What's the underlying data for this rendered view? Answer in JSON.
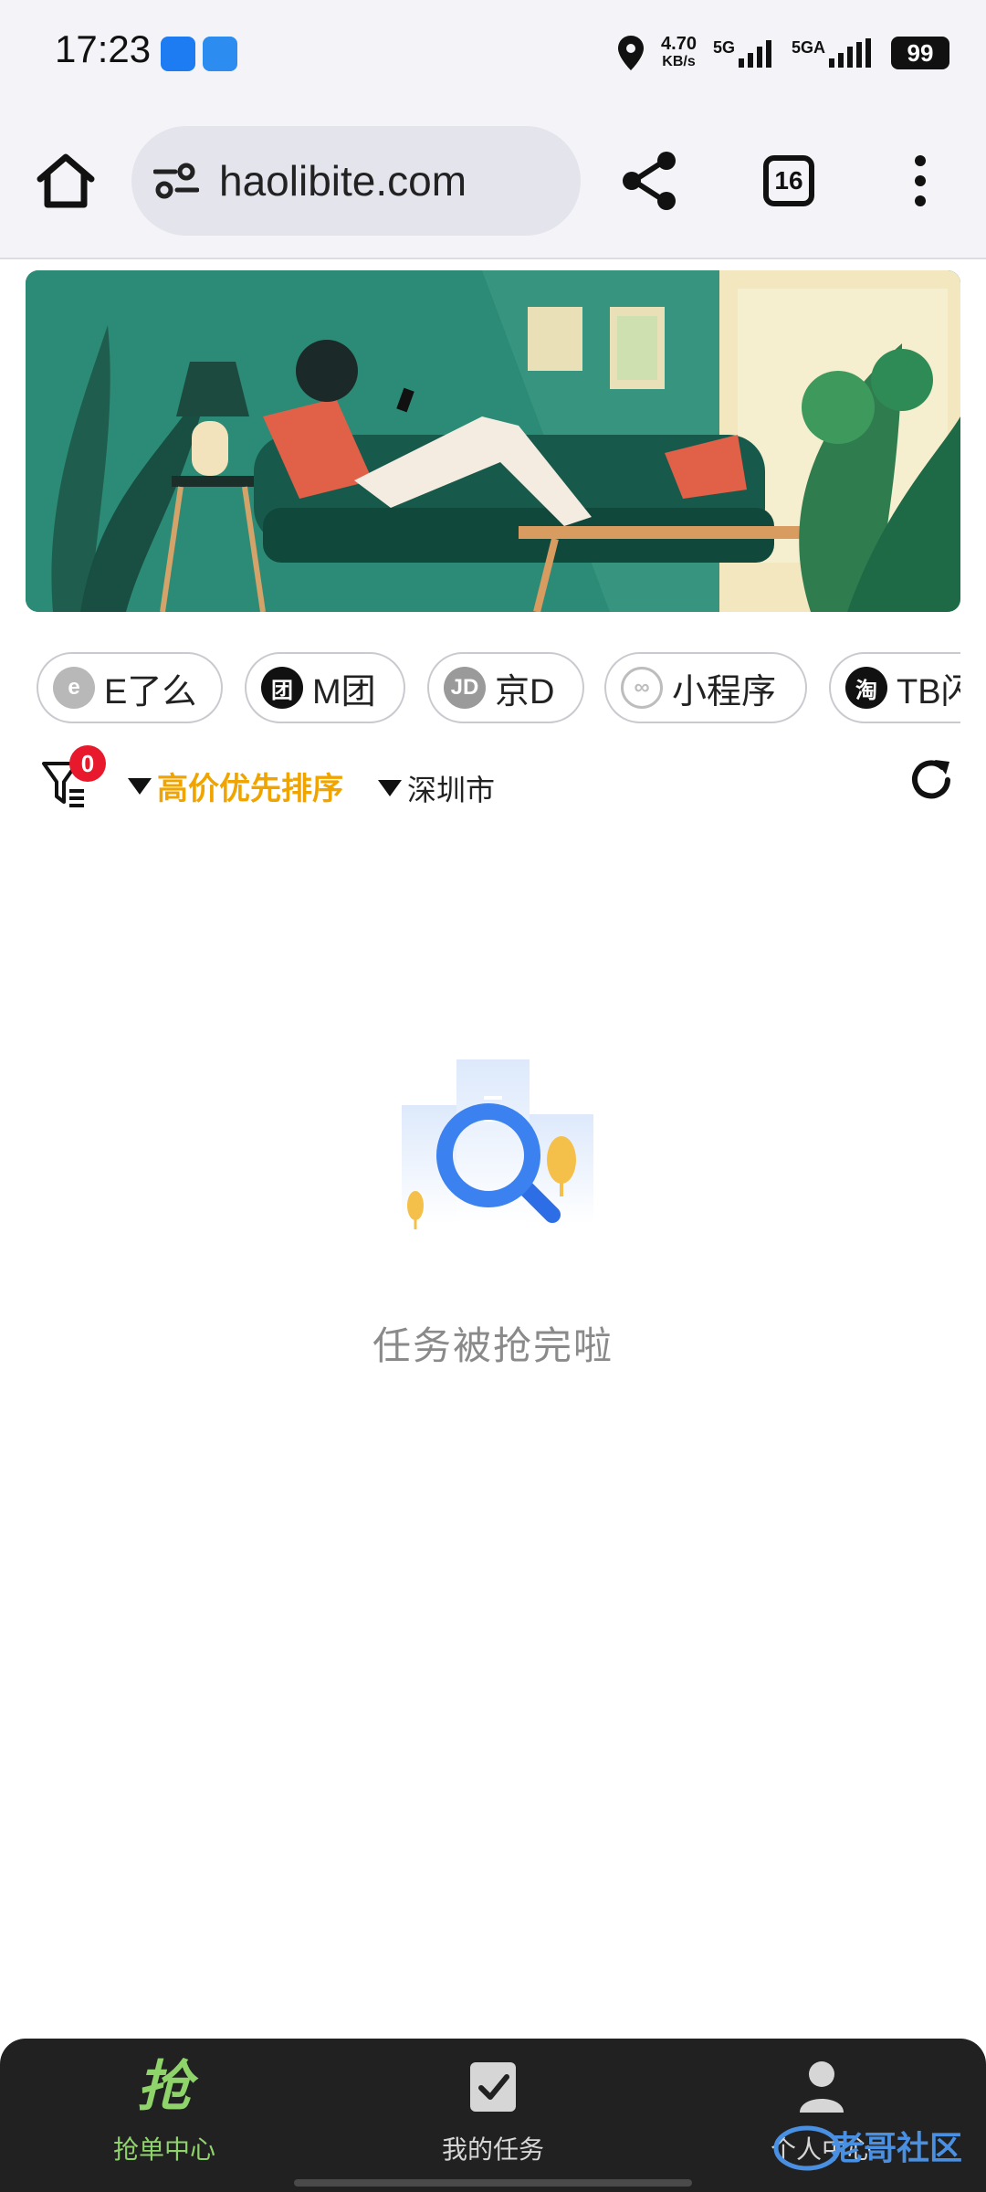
{
  "status_bar": {
    "time": "17:23",
    "net_speed_value": "4.70",
    "net_speed_unit": "KB/s",
    "sim1": "5G",
    "sim2": "5GA",
    "battery": "99"
  },
  "browser": {
    "url": "haolibite.com",
    "tab_count": "16"
  },
  "chips": [
    {
      "label": "E了么",
      "icon_text": "e",
      "icon_color": "#b8b8b8"
    },
    {
      "label": "M团",
      "icon_text": "团",
      "icon_color": "#111111"
    },
    {
      "label": "京D",
      "icon_text": "JD",
      "icon_color": "#9a9a9a"
    },
    {
      "label": "小程序",
      "icon_text": "∞",
      "icon_color": "#bdbdbd"
    },
    {
      "label": "TB闪",
      "icon_text": "淘",
      "icon_color": "#111111"
    }
  ],
  "filter": {
    "badge_count": "0",
    "sort_label": "高价优先排序",
    "city_label": "深圳市"
  },
  "empty_state": {
    "message": "任务被抢完啦"
  },
  "bottom_nav": {
    "items": [
      {
        "label": "抢单中心",
        "icon_text": "抢"
      },
      {
        "label": "我的任务"
      },
      {
        "label": "个人中心"
      }
    ]
  },
  "watermark": {
    "text": "老哥社区"
  },
  "colors": {
    "accent_sort": "#f0a400",
    "nav_active": "#8fd36b",
    "badge": "#e8192c"
  }
}
